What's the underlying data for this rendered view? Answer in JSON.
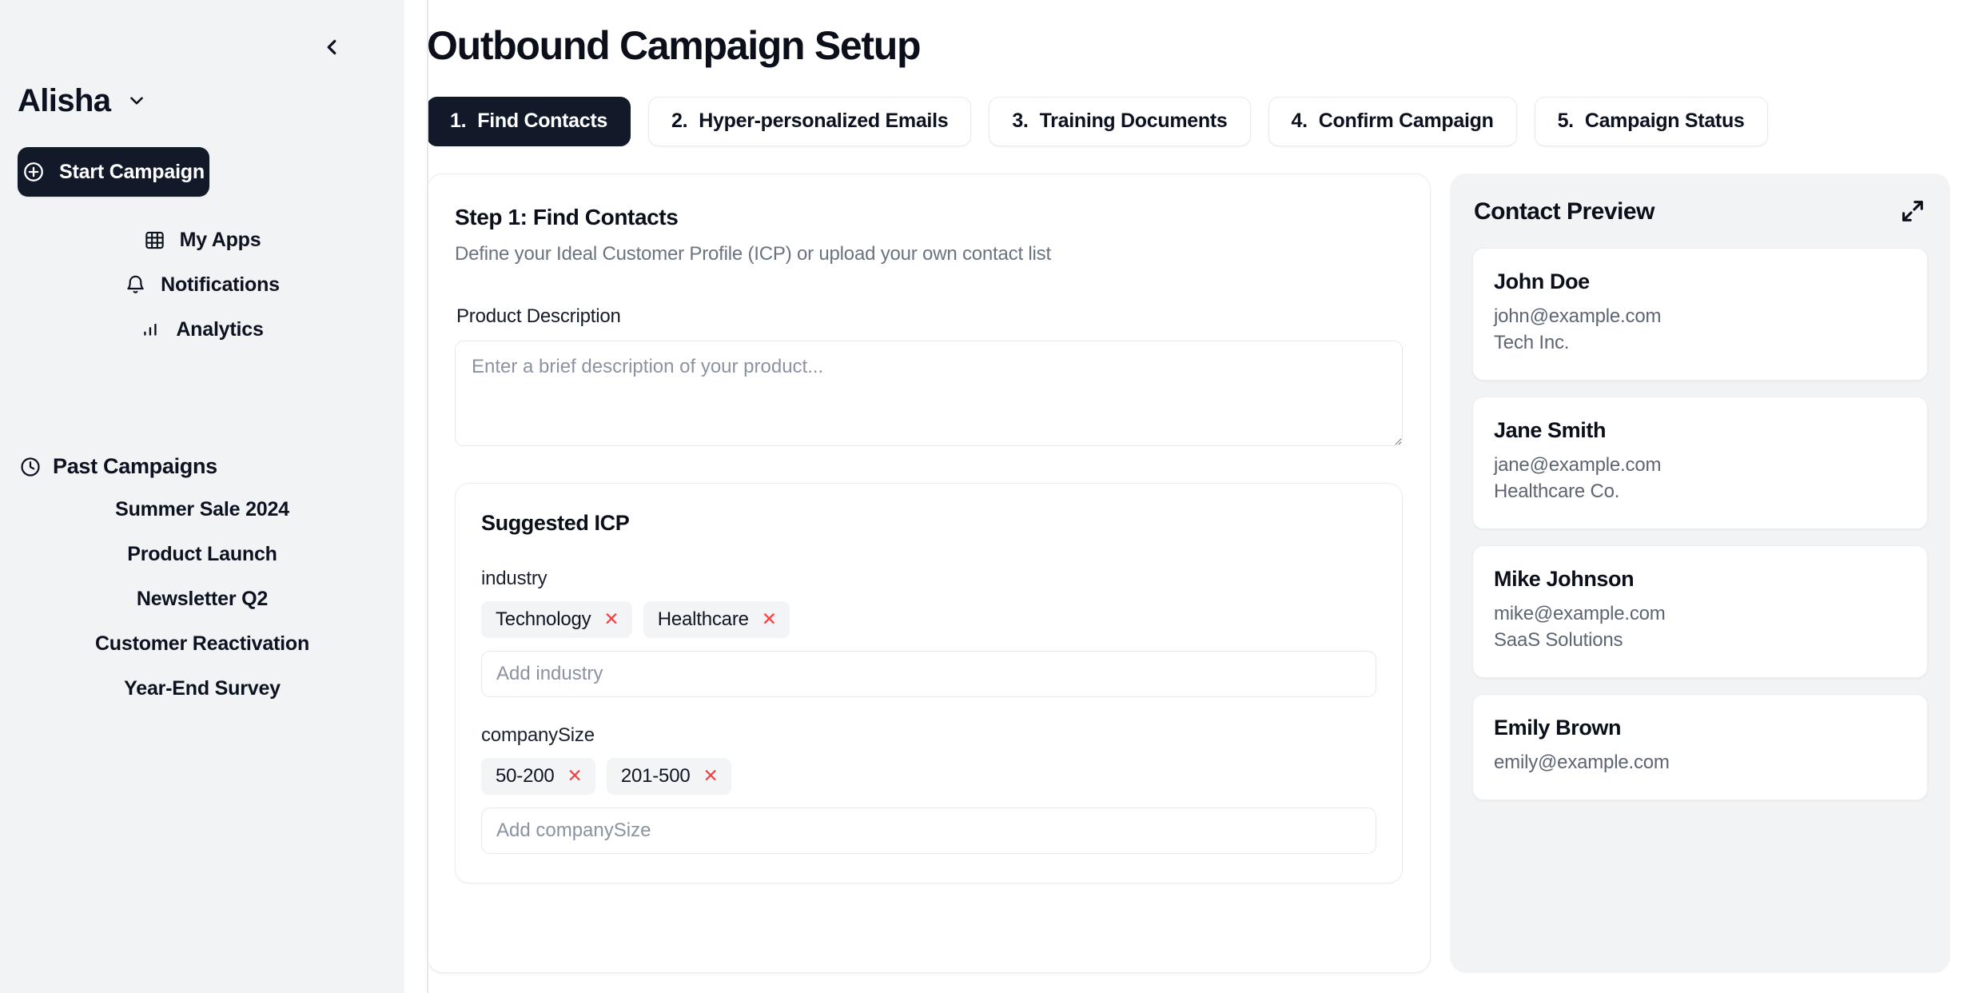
{
  "sidebar": {
    "collapse_icon": "chevron-left-icon",
    "workspace": {
      "name": "Alisha",
      "caret_icon": "chevron-down-icon"
    },
    "start_campaign": {
      "label": "Start Campaign",
      "icon": "plus-circle-icon"
    },
    "nav_items": [
      {
        "label": "My Apps",
        "icon": "grid-icon"
      },
      {
        "label": "Notifications",
        "icon": "bell-icon"
      },
      {
        "label": "Analytics",
        "icon": "bar-chart-icon"
      }
    ],
    "past_campaigns": {
      "title": "Past Campaigns",
      "icon": "clock-icon",
      "items": [
        {
          "label": "Summer Sale 2024"
        },
        {
          "label": "Product Launch"
        },
        {
          "label": "Newsletter Q2"
        },
        {
          "label": "Customer Reactivation"
        },
        {
          "label": "Year-End Survey"
        }
      ]
    }
  },
  "header": {
    "title": "Outbound Campaign Setup"
  },
  "tabs": [
    {
      "num": "1.",
      "label": "Find Contacts",
      "active": true
    },
    {
      "num": "2.",
      "label": "Hyper-personalized Emails",
      "active": false
    },
    {
      "num": "3.",
      "label": "Training Documents",
      "active": false
    },
    {
      "num": "4.",
      "label": "Confirm Campaign",
      "active": false
    },
    {
      "num": "5.",
      "label": "Campaign Status",
      "active": false
    }
  ],
  "step_card": {
    "title": "Step 1: Find Contacts",
    "subtitle": "Define your Ideal Customer Profile (ICP) or upload your own contact list",
    "product_description": {
      "label": "Product Description",
      "placeholder": "Enter a brief description of your product...",
      "value": ""
    },
    "icp": {
      "title": "Suggested ICP",
      "fields": [
        {
          "name": "industry",
          "chips": [
            "Technology",
            "Healthcare"
          ],
          "remove_icon": "close-x-icon",
          "input_placeholder": "Add industry",
          "input_value": ""
        },
        {
          "name": "companySize",
          "chips": [
            "50-200",
            "201-500"
          ],
          "remove_icon": "close-x-icon",
          "input_placeholder": "Add companySize",
          "input_value": ""
        }
      ]
    }
  },
  "preview": {
    "title": "Contact Preview",
    "expand_icon": "expand-diagonal-icon",
    "contacts": [
      {
        "name": "John Doe",
        "email": "john@example.com",
        "company": "Tech Inc."
      },
      {
        "name": "Jane Smith",
        "email": "jane@example.com",
        "company": "Healthcare Co."
      },
      {
        "name": "Mike Johnson",
        "email": "mike@example.com",
        "company": "SaaS Solutions"
      },
      {
        "name": "Emily Brown",
        "email": "emily@example.com",
        "company": ""
      }
    ]
  },
  "colors": {
    "accent_dark": "#121a2a",
    "sidebar_bg": "#f1f3f5",
    "danger": "#ef4444",
    "muted_text": "#6b7380"
  }
}
